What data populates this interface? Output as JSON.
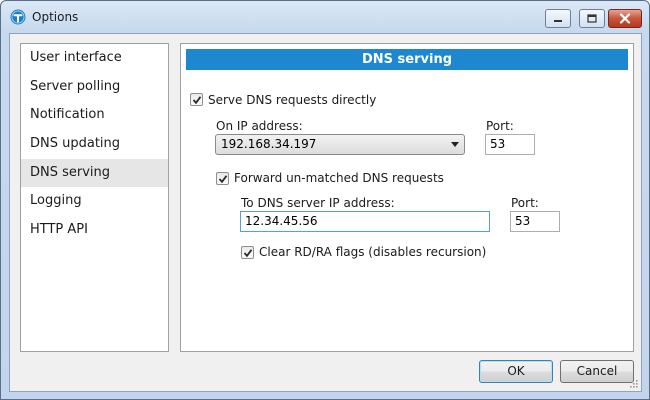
{
  "window": {
    "title": "Options",
    "controls": {
      "minimize": "minimize",
      "maximize": "maximize",
      "close": "close"
    }
  },
  "sidebar": {
    "items": [
      {
        "label": "User interface"
      },
      {
        "label": "Server polling"
      },
      {
        "label": "Notification"
      },
      {
        "label": "DNS updating"
      },
      {
        "label": "DNS serving",
        "selected": true
      },
      {
        "label": "Logging"
      },
      {
        "label": "HTTP API"
      }
    ]
  },
  "panel": {
    "header": "DNS serving",
    "serve_directly": {
      "label": "Serve DNS requests directly",
      "checked": true
    },
    "on_ip": {
      "label": "On IP address:",
      "value": "192.168.34.197"
    },
    "port1": {
      "label": "Port:",
      "value": "53"
    },
    "forward": {
      "label": "Forward un-matched DNS requests",
      "checked": true
    },
    "to_dns": {
      "label": "To DNS server IP address:",
      "value": "12.34.45.56"
    },
    "port2": {
      "label": "Port:",
      "value": "53"
    },
    "clear_flags": {
      "label": "Clear RD/RA flags (disables recursion)",
      "checked": true
    }
  },
  "footer": {
    "ok_label": "OK",
    "cancel_label": "Cancel"
  },
  "colors": {
    "accent": "#1d88cf",
    "selection": "#e6e6e6",
    "close_button": "#c9553b"
  }
}
